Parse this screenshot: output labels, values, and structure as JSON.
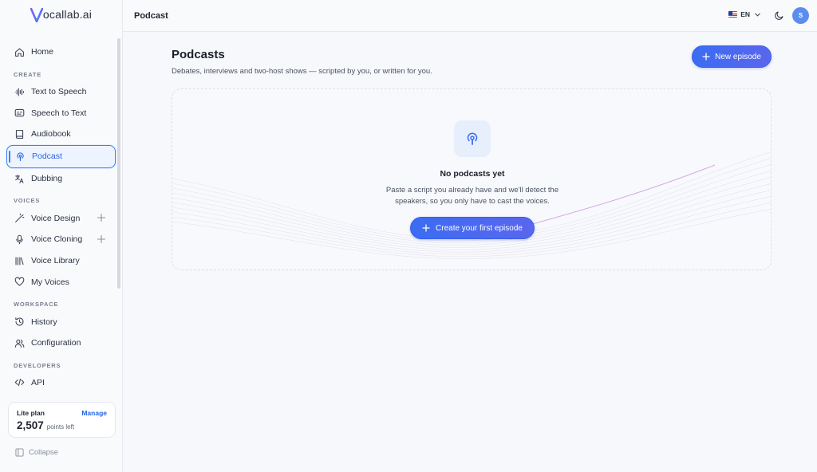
{
  "app": {
    "logo_initial": "V",
    "logo_text": "ocallab.ai"
  },
  "sidebar": {
    "home": "Home",
    "sections": {
      "create": "CREATE",
      "voices": "VOICES",
      "workspace": "WORKSPACE",
      "developers": "DEVELOPERS"
    },
    "create_items": [
      "Text to Speech",
      "Speech to Text",
      "Audiobook",
      "Podcast",
      "Dubbing"
    ],
    "voices_items": [
      "Voice Design",
      "Voice Cloning",
      "Voice Library",
      "My Voices"
    ],
    "workspace_items": [
      "History",
      "Configuration"
    ],
    "developers_items": [
      "API"
    ],
    "plan": {
      "name": "Lite plan",
      "manage": "Manage",
      "points": "2,507",
      "points_unit": "points left"
    },
    "collapse": "Collapse"
  },
  "topbar": {
    "title": "Podcast",
    "language": "EN",
    "avatar_initial": "S"
  },
  "main": {
    "title": "Podcasts",
    "subtitle": "Debates, interviews and two-host shows — scripted by you, or written for you.",
    "new_button": "New episode",
    "empty": {
      "title": "No podcasts yet",
      "description": "Paste a script you already have and we'll detect the speakers, so you only have to cast the voices.",
      "cta": "Create your first episode"
    }
  },
  "colors": {
    "accent": "#3b6cf2",
    "active_border": "#3b82f6",
    "text": "#1f2430"
  }
}
